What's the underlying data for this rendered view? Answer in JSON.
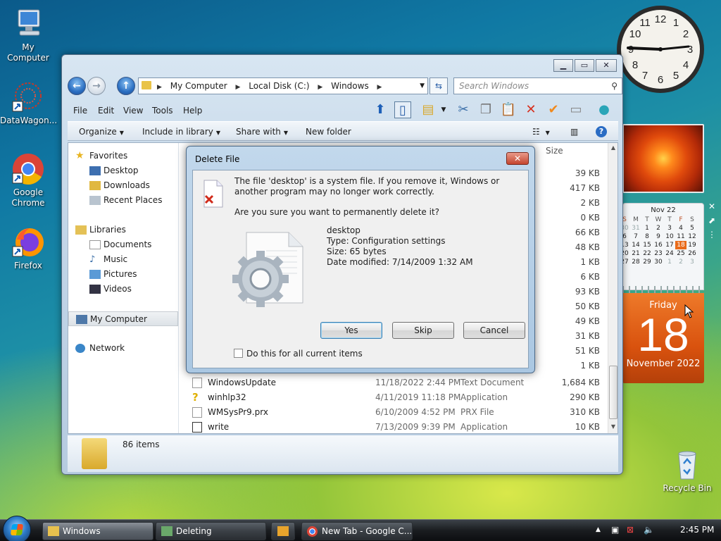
{
  "desktop": {
    "icons": [
      {
        "label": "My Computer"
      },
      {
        "label": "DataWagon..."
      },
      {
        "label": "Google Chrome"
      },
      {
        "label": "Firefox"
      },
      {
        "label": "Recycle Bin"
      }
    ]
  },
  "calendar_gadget": {
    "month_label": "Nov 22",
    "weekday_headers": [
      "S",
      "M",
      "T",
      "W",
      "T",
      "F",
      "S"
    ],
    "weeks": [
      [
        "30",
        "31",
        "1",
        "2",
        "3",
        "4",
        "5"
      ],
      [
        "6",
        "7",
        "8",
        "9",
        "10",
        "11",
        "12"
      ],
      [
        "13",
        "14",
        "15",
        "16",
        "17",
        "18",
        "19"
      ],
      [
        "20",
        "21",
        "22",
        "23",
        "24",
        "25",
        "26"
      ],
      [
        "27",
        "28",
        "29",
        "30",
        "1",
        "2",
        "3"
      ]
    ],
    "selected_day": "18",
    "day_of_week": "Friday",
    "day_number": "18",
    "month_year": "November 2022"
  },
  "explorer": {
    "breadcrumb": [
      "My Computer",
      "Local Disk (C:)",
      "Windows"
    ],
    "search_placeholder": "Search Windows",
    "menu": [
      "File",
      "Edit",
      "View",
      "Tools",
      "Help"
    ],
    "commands": [
      "Organize",
      "Include in library",
      "Share with",
      "New folder"
    ],
    "nav": {
      "favorites_header": "Favorites",
      "favorites": [
        "Desktop",
        "Downloads",
        "Recent Places"
      ],
      "libraries_header": "Libraries",
      "libraries": [
        "Documents",
        "Music",
        "Pictures",
        "Videos"
      ],
      "computer": "My Computer",
      "network": "Network"
    },
    "size_header": "Size",
    "sizes_visible": [
      "39 KB",
      "417 KB",
      "2 KB",
      "0 KB",
      "66 KB",
      "48 KB",
      "1 KB",
      "6 KB",
      "93 KB",
      "50 KB",
      "49 KB",
      "31 KB",
      "51 KB",
      "1 KB"
    ],
    "rows": [
      {
        "name": "WindowsUpdate",
        "date": "11/18/2022 2:44 PM",
        "type": "Text Document",
        "size": "1,684 KB"
      },
      {
        "name": "winhlp32",
        "date": "4/11/2019 11:18 PM",
        "type": "Application",
        "size": "290 KB"
      },
      {
        "name": "WMSysPr9.prx",
        "date": "6/10/2009 4:52 PM",
        "type": "PRX File",
        "size": "310 KB"
      },
      {
        "name": "write",
        "date": "7/13/2009 9:39 PM",
        "type": "Application",
        "size": "10 KB"
      }
    ],
    "item_count": "86 items"
  },
  "dialog": {
    "title": "Delete File",
    "close_label": "✕",
    "message": "The file 'desktop' is a system file. If you remove it, Windows or another program may no longer work correctly.",
    "question": "Are you sure you want to permanently delete it?",
    "file_name": "desktop",
    "file_type": "Type: Configuration settings",
    "file_size": "Size: 65 bytes",
    "file_modified": "Date modified: 7/14/2009 1:32 AM",
    "yes": "Yes",
    "skip": "Skip",
    "cancel": "Cancel",
    "checkbox": "Do this for all current items"
  },
  "taskbar": {
    "buttons": [
      "Windows",
      "Deleting",
      "New Tab - Google C..."
    ],
    "clock": "2:45 PM"
  }
}
